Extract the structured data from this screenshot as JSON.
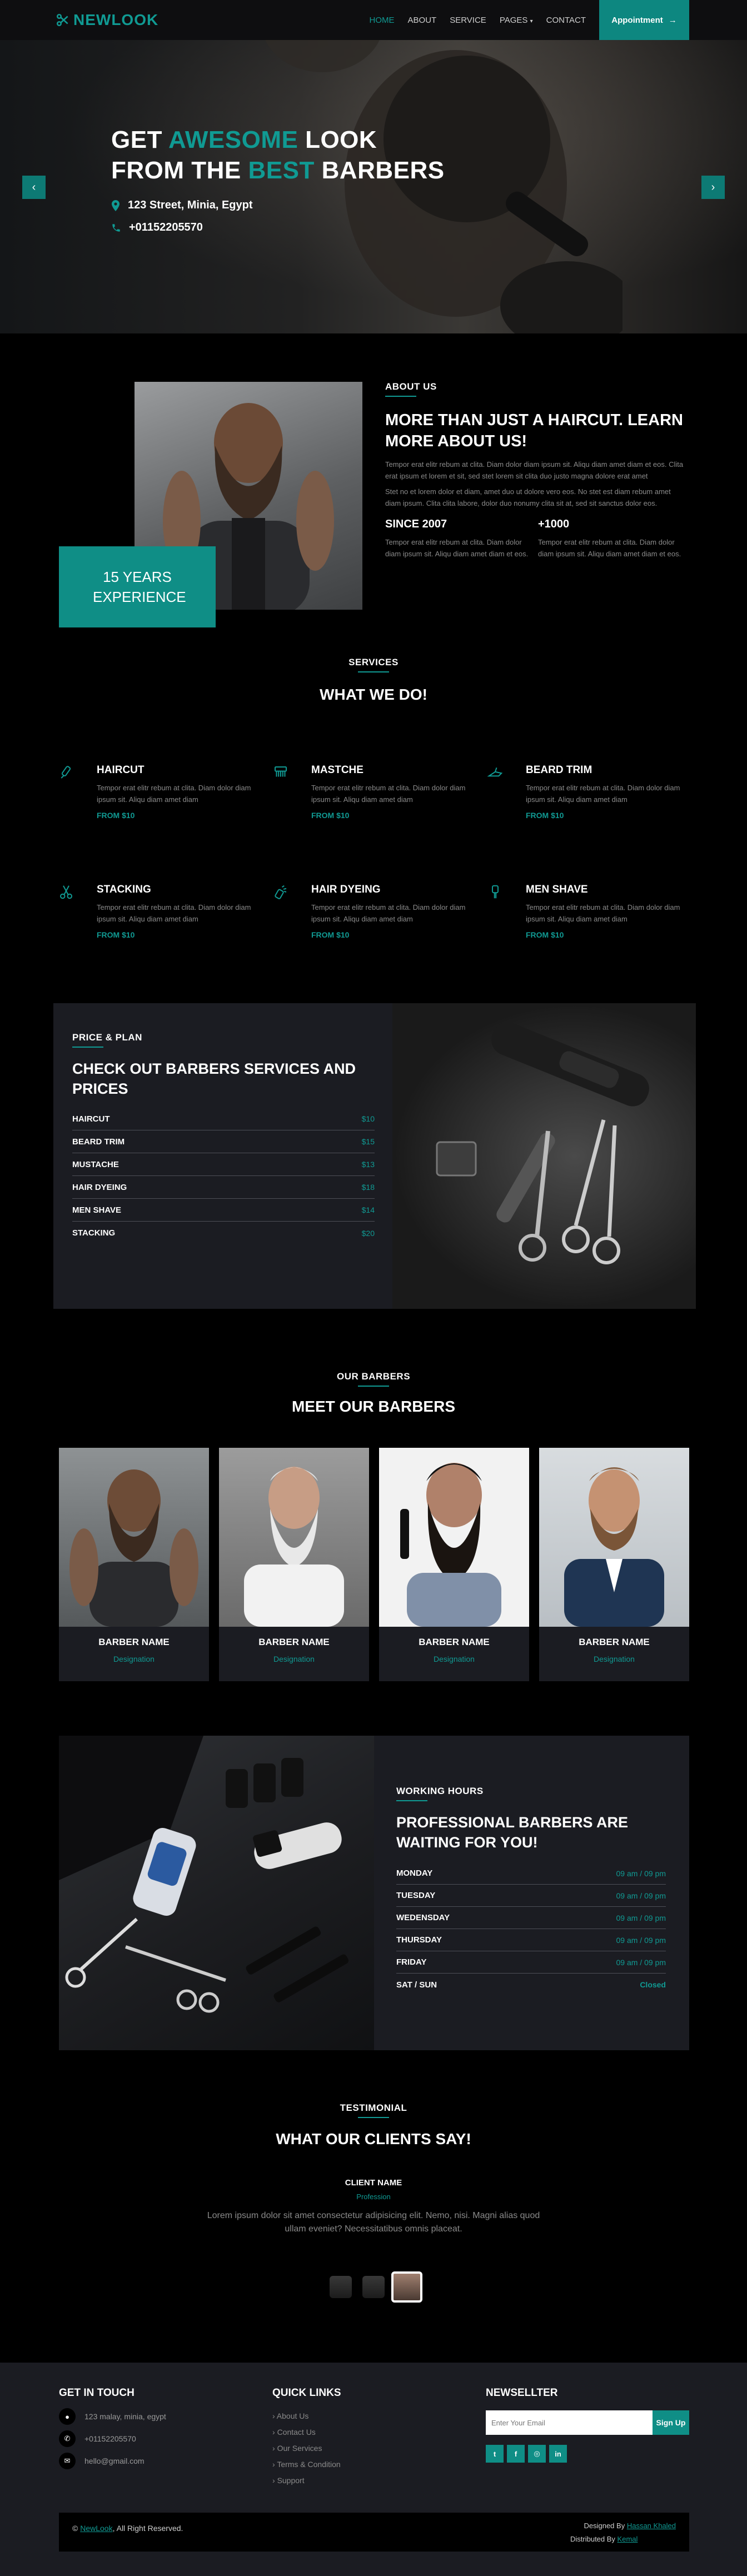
{
  "nav": {
    "logo": "NEWLOOK",
    "items": [
      "HOME",
      "ABOUT",
      "SERVICE",
      "PAGES",
      "CONTACT"
    ],
    "active": "HOME",
    "appointment": "Appointment"
  },
  "hero": {
    "line1_a": "GET ",
    "line1_b": "AWESOME",
    "line1_c": " LOOK",
    "line2_a": "FROM THE ",
    "line2_b": "BEST",
    "line2_c": " BARBERS",
    "address": "123 Street, Minia, Egypt",
    "phone": "+01152205570",
    "prev_icon": "chevron-left-icon",
    "next_icon": "chevron-right-icon"
  },
  "about": {
    "tag": "ABOUT US",
    "title": "MORE THAN JUST A HAIRCUT. LEARN MORE ABOUT US!",
    "p1": "Tempor erat elitr rebum at clita. Diam dolor diam ipsum sit. Aliqu diam amet diam et eos. Clita erat ipsum et lorem et sit, sed stet lorem sit clita duo justo magna dolore erat amet",
    "p2": "Stet no et lorem dolor et diam, amet duo ut dolore vero eos. No stet est diam rebum amet diam ipsum. Clita clita labore, dolor duo nonumy clita sit at, sed sit sanctus dolor eos.",
    "stat1_title": "SINCE 2007",
    "stat1_text": "Tempor erat elitr rebum at clita. Diam dolor diam ipsum sit. Aliqu diam amet diam et eos.",
    "stat2_title": "+1000",
    "stat2_text": "Tempor erat elitr rebum at clita. Diam dolor diam ipsum sit. Aliqu diam amet diam et eos.",
    "experience": "15 YEARS EXPERIENCE"
  },
  "services": {
    "tag": "SERVICES",
    "title": "WHAT WE DO!",
    "items": [
      {
        "name": "HAIRCUT",
        "text": "Tempor erat elitr rebum at clita. Diam dolor diam ipsum sit. Aliqu diam amet diam",
        "price": "FROM $10",
        "icon": "clipper-icon"
      },
      {
        "name": "MASTCHE",
        "text": "Tempor erat elitr rebum at clita. Diam dolor diam ipsum sit. Aliqu diam amet diam",
        "price": "FROM $10",
        "icon": "comb-icon"
      },
      {
        "name": "BEARD TRIM",
        "text": "Tempor erat elitr rebum at clita. Diam dolor diam ipsum sit. Aliqu diam amet diam",
        "price": "FROM $10",
        "icon": "razor-icon"
      },
      {
        "name": "STACKING",
        "text": "Tempor erat elitr rebum at clita. Diam dolor diam ipsum sit. Aliqu diam amet diam",
        "price": "FROM $10",
        "icon": "scissors-icon"
      },
      {
        "name": "HAIR DYEING",
        "text": "Tempor erat elitr rebum at clita. Diam dolor diam ipsum sit. Aliqu diam amet diam",
        "price": "FROM $10",
        "icon": "spray-icon"
      },
      {
        "name": "MEN SHAVE",
        "text": "Tempor erat elitr rebum at clita. Diam dolor diam ipsum sit. Aliqu diam amet diam",
        "price": "FROM $10",
        "icon": "shaver-icon"
      }
    ]
  },
  "price": {
    "tag": "PRICE & PLAN",
    "title": "CHECK OUT BARBERS SERVICES AND PRICES",
    "rows": [
      {
        "name": "HAIRCUT",
        "value": "$10"
      },
      {
        "name": "BEARD TRIM",
        "value": "$15"
      },
      {
        "name": "MUSTACHE",
        "value": "$13"
      },
      {
        "name": "HAIR DYEING",
        "value": "$18"
      },
      {
        "name": "MEN SHAVE",
        "value": "$14"
      },
      {
        "name": "STACKING",
        "value": "$20"
      }
    ]
  },
  "barbers": {
    "tag": "OUR BARBERS",
    "title": "MEET OUR BARBERS",
    "cards": [
      {
        "name": "BARBER NAME",
        "role": "Designation"
      },
      {
        "name": "BARBER NAME",
        "role": "Designation"
      },
      {
        "name": "BARBER NAME",
        "role": "Designation"
      },
      {
        "name": "BARBER NAME",
        "role": "Designation"
      }
    ]
  },
  "hours": {
    "tag": "WORKING HOURS",
    "title": "PROFESSIONAL BARBERS ARE WAITING FOR YOU!",
    "rows": [
      {
        "day": "MONDAY",
        "time": "09 am / 09 pm"
      },
      {
        "day": "TUESDAY",
        "time": "09 am / 09 pm"
      },
      {
        "day": "WEDENSDAY",
        "time": "09 am / 09 pm"
      },
      {
        "day": "THURSDAY",
        "time": "09 am / 09 pm"
      },
      {
        "day": "FRIDAY",
        "time": "09 am / 09 pm"
      },
      {
        "day": "SAT / SUN",
        "time": "Closed"
      }
    ]
  },
  "testimonial": {
    "tag": "TESTIMONIAL",
    "title": "WHAT OUR CLIENTS SAY!",
    "client": "CLIENT NAME",
    "profession": "Profession",
    "quote": "Lorem ipsum dolor sit amet consectetur adipisicing elit. Nemo, nisi. Magni alias quod ullam eveniet? Necessitatibus omnis placeat."
  },
  "footer": {
    "touch_title": "GET IN TOUCH",
    "address": "123 malay, minia, egypt",
    "phone": "+01152205570",
    "email": "hello@gmail.com",
    "links_title": "QUICK LINKS",
    "links": [
      "About Us",
      "Contact Us",
      "Our Services",
      "Terms & Condition",
      "Support"
    ],
    "news_title": "NEWSELLTER",
    "email_placeholder": "Enter Your Email",
    "signup": "Sign Up",
    "social": [
      "twitter-icon",
      "facebook-icon",
      "instagram-icon",
      "linkedin-icon"
    ],
    "copy_prefix": "©",
    "copy_brand": "NewLook",
    "copy_suffix": ", All Right Reserved.",
    "designed_prefix": "Designed By",
    "designer": "Hassan Khaled",
    "distributed_prefix": "Distributed By",
    "distributor": "Kemal"
  },
  "colors": {
    "accent": "#109a93",
    "panel": "#1b1c22",
    "background": "#000000"
  }
}
